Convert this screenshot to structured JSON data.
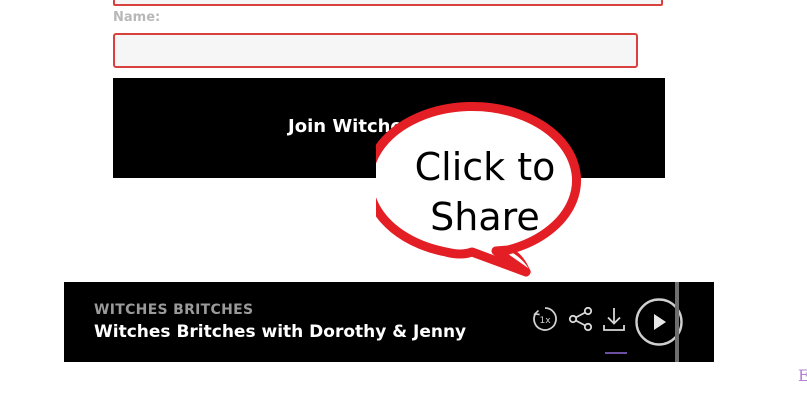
{
  "form": {
    "name_label": "Name:",
    "name_value": "",
    "join_button_label": "Join Witches B"
  },
  "player": {
    "podcast_name": "WITCHES BRITCHES",
    "episode_title": "Witches Britches with Dorothy & Jenny",
    "speed_label": "1x",
    "icons": {
      "speed": "playback-speed-icon",
      "share": "share-icon",
      "download": "download-icon",
      "play": "play-icon"
    }
  },
  "callout": {
    "line1": "Click to",
    "line2": "Share"
  },
  "corner": {
    "letter": "E"
  },
  "colors": {
    "accent_red": "#e31e24",
    "player_bg": "#000000",
    "field_border": "#d9413f"
  }
}
